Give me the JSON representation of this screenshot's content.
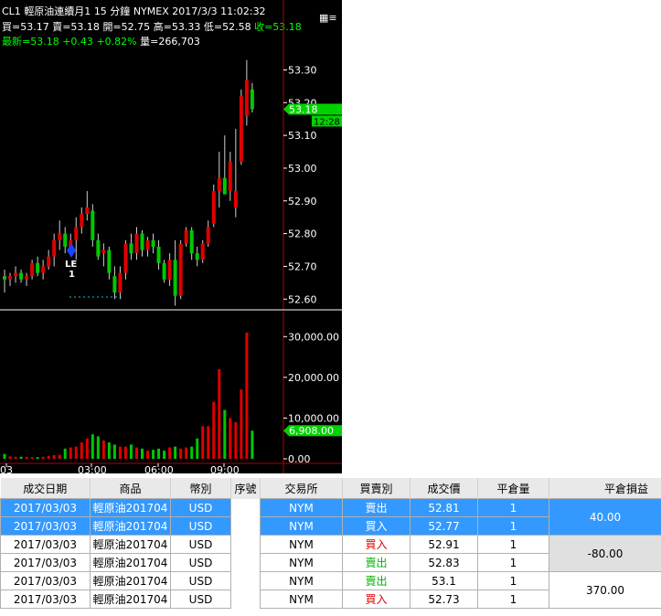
{
  "header": {
    "line1": {
      "symbol": "CL1",
      "name": "輕原油連續月1",
      "interval": "15 分鐘",
      "exchange": "NYMEX",
      "date": "2017/3/3",
      "time": "11:02:32"
    },
    "line2": {
      "bid": "買=53.17",
      "ask": "賣=53.18",
      "open": "開=52.75",
      "high": "高=53.33",
      "low": "低=52.58",
      "close": "收=53.18"
    },
    "line3": {
      "last": "最新=53.18",
      "change": "+0.43",
      "pct": "+0.82%",
      "volume": "量=266,703"
    }
  },
  "chart_data": [
    {
      "type": "candlestick",
      "y_ticks": [
        "53.30",
        "53.20",
        "53.10",
        "53.00",
        "52.90",
        "52.80",
        "52.70",
        "52.60"
      ],
      "ylim": [
        52.57,
        53.36
      ],
      "x_ticks": [
        "03",
        "03:00",
        "06:00",
        "09:00"
      ],
      "last_price_tag": "53.18",
      "countdown_tag": "12:28",
      "marker": {
        "label": "LE",
        "sub": "1"
      },
      "candles": [
        [
          52.67,
          52.69,
          52.62,
          52.66
        ],
        [
          52.66,
          52.68,
          52.64,
          52.67
        ],
        [
          52.67,
          52.7,
          52.65,
          52.68
        ],
        [
          52.68,
          52.69,
          52.65,
          52.66
        ],
        [
          52.66,
          52.68,
          52.64,
          52.67
        ],
        [
          52.67,
          52.72,
          52.66,
          52.71
        ],
        [
          52.71,
          52.73,
          52.67,
          52.68
        ],
        [
          52.68,
          52.72,
          52.66,
          52.7
        ],
        [
          52.7,
          52.75,
          52.69,
          52.73
        ],
        [
          52.73,
          52.8,
          52.7,
          52.78
        ],
        [
          52.78,
          52.84,
          52.75,
          52.8
        ],
        [
          52.8,
          52.82,
          52.74,
          52.76
        ],
        [
          52.76,
          52.8,
          52.74,
          52.78
        ],
        [
          52.78,
          52.85,
          52.72,
          52.82
        ],
        [
          52.82,
          52.88,
          52.8,
          52.86
        ],
        [
          52.86,
          52.93,
          52.84,
          52.88
        ],
        [
          52.87,
          52.89,
          52.76,
          52.78
        ],
        [
          52.78,
          52.8,
          52.72,
          52.73
        ],
        [
          52.74,
          52.77,
          52.7,
          52.75
        ],
        [
          52.75,
          52.76,
          52.66,
          52.68
        ],
        [
          52.67,
          52.7,
          52.6,
          52.62
        ],
        [
          52.62,
          52.7,
          52.6,
          52.68
        ],
        [
          52.68,
          52.78,
          52.66,
          52.77
        ],
        [
          52.77,
          52.8,
          52.72,
          52.74
        ],
        [
          52.74,
          52.82,
          52.72,
          52.8
        ],
        [
          52.8,
          52.81,
          52.73,
          52.75
        ],
        [
          52.75,
          52.79,
          52.73,
          52.78
        ],
        [
          52.78,
          52.8,
          52.74,
          52.76
        ],
        [
          52.76,
          52.78,
          52.69,
          52.71
        ],
        [
          52.71,
          52.72,
          52.65,
          52.66
        ],
        [
          52.66,
          52.74,
          52.64,
          52.72
        ],
        [
          52.72,
          52.78,
          52.58,
          52.61
        ],
        [
          52.61,
          52.78,
          52.6,
          52.77
        ],
        [
          52.77,
          52.82,
          52.76,
          52.81
        ],
        [
          52.81,
          52.82,
          52.72,
          52.74
        ],
        [
          52.74,
          52.76,
          52.7,
          52.72
        ],
        [
          52.72,
          52.78,
          52.71,
          52.77
        ],
        [
          52.77,
          52.84,
          52.76,
          52.82
        ],
        [
          52.83,
          52.95,
          52.82,
          52.93
        ],
        [
          52.93,
          53.05,
          52.88,
          52.97
        ],
        [
          52.97,
          53.1,
          52.92,
          52.92
        ],
        [
          52.93,
          53.05,
          52.9,
          53.02
        ],
        [
          52.88,
          53.12,
          52.85,
          52.93
        ],
        [
          53.02,
          53.24,
          53.01,
          53.22
        ],
        [
          53.16,
          53.33,
          53.13,
          53.27
        ],
        [
          53.24,
          53.26,
          53.17,
          53.18
        ]
      ]
    },
    {
      "type": "bar",
      "y_ticks": [
        "30,000.00",
        "20,000.00",
        "10,000.00",
        "0.00"
      ],
      "ylim": [
        0,
        32000
      ],
      "last_volume_tag": "6,908.00",
      "values": [
        1200,
        600,
        500,
        500,
        500,
        400,
        400,
        500,
        700,
        900,
        1000,
        2500,
        2800,
        3000,
        4000,
        5000,
        6000,
        5500,
        4500,
        4000,
        3500,
        3000,
        3000,
        3500,
        2800,
        2500,
        2000,
        2200,
        2500,
        2000,
        2800,
        3000,
        2500,
        2800,
        3000,
        5000,
        8000,
        8000,
        14000,
        22000,
        12000,
        10000,
        9000,
        17000,
        31000,
        6908
      ]
    }
  ],
  "table": {
    "headers": [
      "成交日期",
      "商品",
      "幣別",
      "序號",
      "交易所",
      "買賣別",
      "成交價",
      "平倉量",
      "平倉損益"
    ],
    "rows": [
      {
        "date": "2017/03/03",
        "product": "輕原油201704",
        "currency": "USD",
        "exchange": "NYM",
        "side": "賣出",
        "price": "52.81",
        "qty": "1"
      },
      {
        "date": "2017/03/03",
        "product": "輕原油201704",
        "currency": "USD",
        "exchange": "NYM",
        "side": "買入",
        "price": "52.77",
        "qty": "1"
      },
      {
        "date": "2017/03/03",
        "product": "輕原油201704",
        "currency": "USD",
        "exchange": "NYM",
        "side": "買入",
        "price": "52.91",
        "qty": "1"
      },
      {
        "date": "2017/03/03",
        "product": "輕原油201704",
        "currency": "USD",
        "exchange": "NYM",
        "side": "賣出",
        "price": "52.83",
        "qty": "1"
      },
      {
        "date": "2017/03/03",
        "product": "輕原油201704",
        "currency": "USD",
        "exchange": "NYM",
        "side": "賣出",
        "price": "53.1",
        "qty": "1"
      },
      {
        "date": "2017/03/03",
        "product": "輕原油201704",
        "currency": "USD",
        "exchange": "NYM",
        "side": "買入",
        "price": "52.73",
        "qty": "1"
      }
    ],
    "pnl": [
      "40.00",
      "-80.00",
      "370.00"
    ]
  },
  "colors": {
    "up": "#e00000",
    "down": "#00c800",
    "tag": "#00d200",
    "grid": "#b00000",
    "select": "#3399ff"
  },
  "icons": {
    "menu": "menu-icon"
  }
}
